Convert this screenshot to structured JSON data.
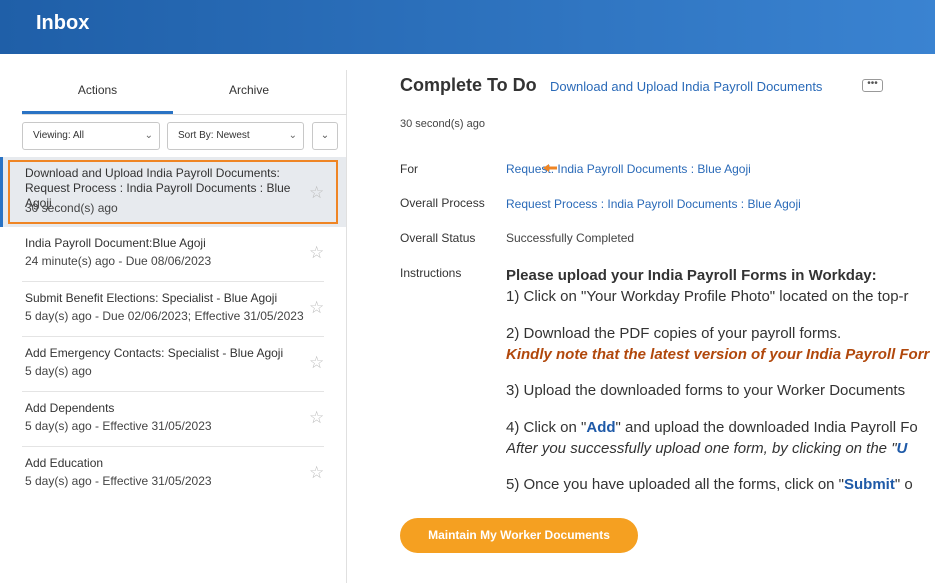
{
  "header": {
    "title": "Inbox"
  },
  "tabs": [
    {
      "label": "Actions"
    },
    {
      "label": "Archive"
    }
  ],
  "filters": {
    "viewing": "Viewing: All",
    "sort": "Sort By: Newest"
  },
  "items": [
    {
      "title": "Download and Upload India Payroll Documents: Request Process : India Payroll Documents : Blue Agoji",
      "sub": "30 second(s) ago"
    },
    {
      "title": "India Payroll Document:Blue Agoji",
      "sub": "24 minute(s) ago - Due 08/06/2023"
    },
    {
      "title": "Submit Benefit Elections: Specialist - Blue Agoji",
      "sub": "5 day(s) ago - Due 02/06/2023; Effective 31/05/2023"
    },
    {
      "title": "Add Emergency Contacts: Specialist - Blue Agoji",
      "sub": "5 day(s) ago"
    },
    {
      "title": "Add Dependents",
      "sub": "5 day(s) ago - Effective 31/05/2023"
    },
    {
      "title": "Add Education",
      "sub": "5 day(s) ago - Effective 31/05/2023"
    }
  ],
  "detail": {
    "heading": "Complete To Do",
    "heading_link": "Download and Upload India Payroll Documents",
    "more": "•••",
    "ago": "30 second(s) ago",
    "for_label": "For",
    "for_value": "Request: India Payroll Documents : Blue Agoji",
    "process_label": "Overall Process",
    "process_value": "Request Process : India Payroll Documents : Blue Agoji",
    "status_label": "Overall Status",
    "status_value": "Successfully Completed",
    "instructions_label": "Instructions",
    "instr_title": "Please upload your India Payroll Forms in Workday:",
    "instr_1": "1) Click on \"Your Workday Profile Photo\" located on the top-r",
    "instr_2": "2) Download the PDF copies of your payroll forms.",
    "instr_2b": "Kindly note that the latest version of your India Payroll Forr",
    "instr_3": "3) Upload the downloaded forms to your Worker Documents",
    "instr_4a": "4) Click on \"",
    "instr_4_add": "Add",
    "instr_4b": "\" and upload the downloaded India Payroll Fo",
    "instr_4c": "After you successfully upload one form, by clicking on the \"",
    "instr_4c_u": "U",
    "instr_5a": "5) Once you have uploaded all the forms, click on \"",
    "instr_5_submit": "Submit",
    "instr_5b": "\" o",
    "cta": "Maintain My Worker Documents"
  },
  "colors": {
    "accent": "#2a73c4",
    "brand": "#1f5fa8",
    "cta": "#f5a021",
    "highlight": "#ef8524"
  }
}
